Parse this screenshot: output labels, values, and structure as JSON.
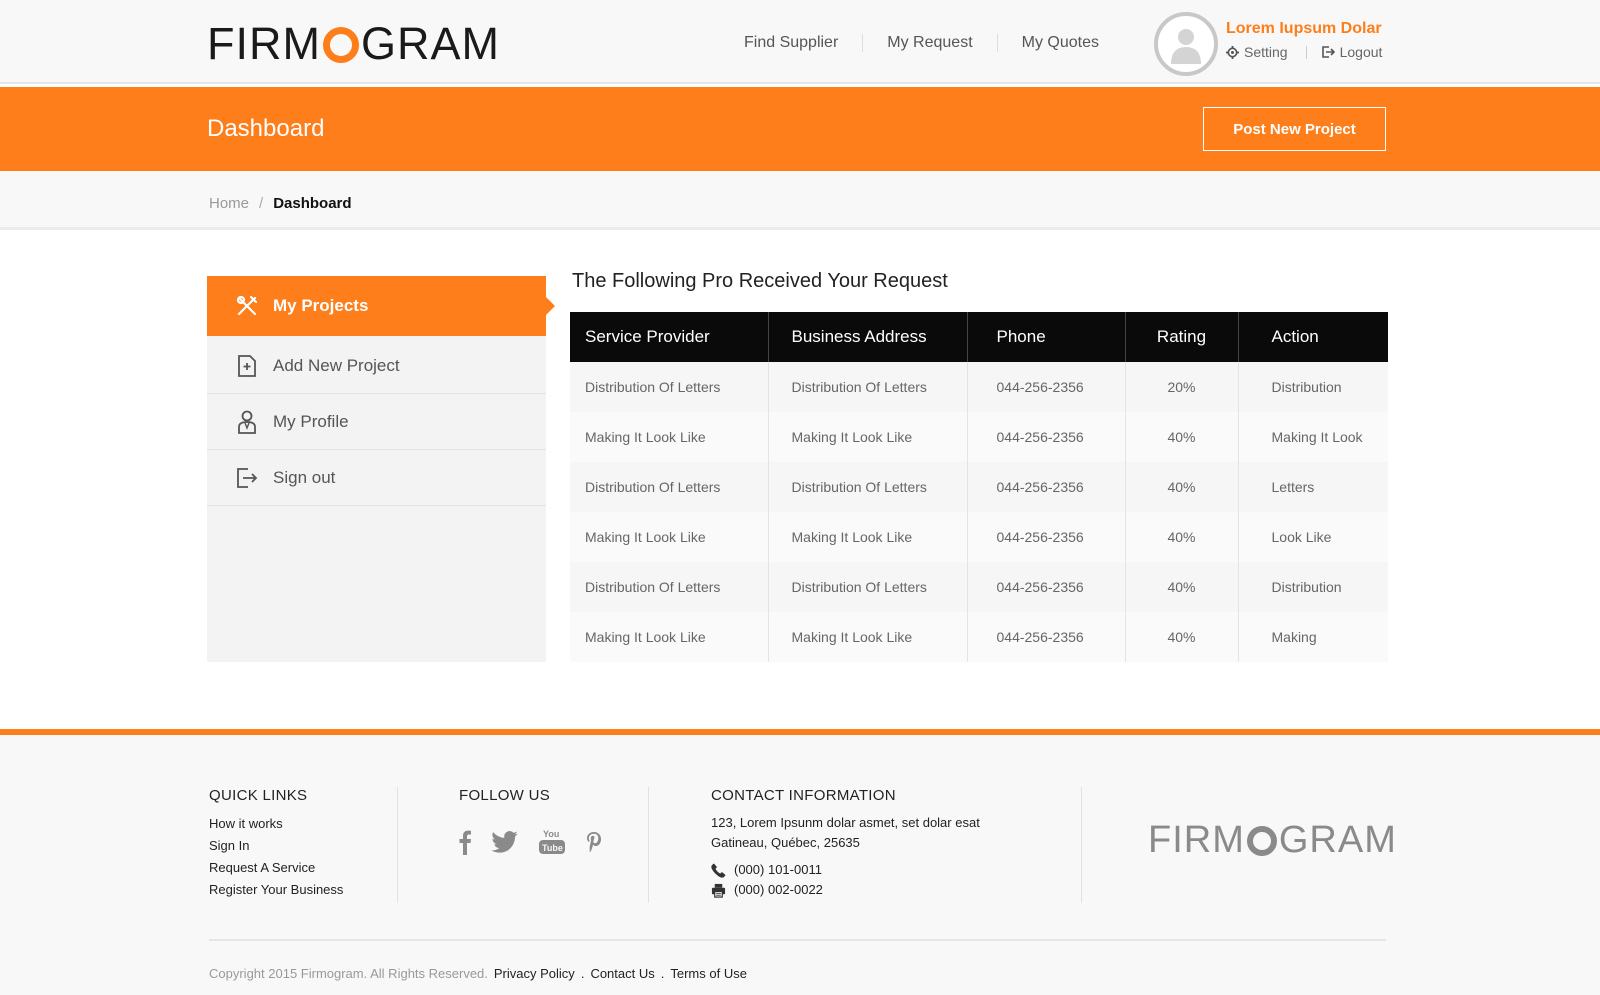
{
  "header": {
    "logo_before": "FIRM",
    "logo_after": "GRAM",
    "nav": [
      "Find Supplier",
      "My Request",
      "My Quotes"
    ],
    "user_name": "Lorem Iupsum Dolar",
    "setting_label": "Setting",
    "logout_label": "Logout"
  },
  "band": {
    "title": "Dashboard",
    "post_button": "Post New Project"
  },
  "breadcrumb": {
    "home": "Home",
    "separator": "/",
    "current": "Dashboard"
  },
  "sidebar": {
    "items": [
      {
        "label": "My Projects",
        "icon": "tools-icon"
      },
      {
        "label": "Add New Project",
        "icon": "add-document-icon"
      },
      {
        "label": "My Profile",
        "icon": "person-icon"
      },
      {
        "label": "Sign out",
        "icon": "sign-out-icon"
      }
    ]
  },
  "table": {
    "title": "The Following Pro Received Your Request",
    "headers": [
      "Service Provider",
      "Business Address",
      "Phone",
      "Rating",
      "Action"
    ],
    "rows": [
      [
        "Distribution Of Letters",
        "Distribution Of Letters",
        "044-256-2356",
        "20%",
        "Distribution"
      ],
      [
        "Making It Look Like",
        "Making It Look Like",
        "044-256-2356",
        "40%",
        "Making It Look"
      ],
      [
        "Distribution Of Letters",
        "Distribution Of Letters",
        "044-256-2356",
        "40%",
        "Letters"
      ],
      [
        "Making It Look Like",
        "Making It Look Like",
        "044-256-2356",
        "40%",
        "Look Like"
      ],
      [
        "Distribution Of Letters",
        "Distribution Of Letters",
        "044-256-2356",
        "40%",
        "Distribution"
      ],
      [
        "Making It Look Like",
        "Making It Look Like",
        "044-256-2356",
        "40%",
        "Making"
      ]
    ]
  },
  "footer": {
    "quick_links_title": "QUICK LINKS",
    "quick_links": [
      "How it works",
      "Sign In",
      "Request A Service",
      "Register Your Business"
    ],
    "follow_title": "FOLLOW US",
    "social": [
      "facebook-icon",
      "twitter-icon",
      "youtube-icon",
      "pinterest-icon"
    ],
    "contact_title": "CONTACT INFORMATION",
    "address_line1": "123, Lorem Ipsunm dolar asmet, set dolar esat",
    "address_line2": "Gatineau, Québec, 25635",
    "phone": "(000) 101-0011",
    "fax": "(000) 002-0022",
    "logo_before": "FIRM",
    "logo_after": "GRAM",
    "copyright": "Copyright 2015  Firmogram.  All Rights Reserved.",
    "links": [
      "Privacy Policy",
      "Contact Us",
      "Terms of Use"
    ],
    "link_separator": "."
  },
  "colors": {
    "accent": "#fd7e1a",
    "table_header": "#0a0a0a",
    "sidebar_bg": "#f3f3f3"
  }
}
